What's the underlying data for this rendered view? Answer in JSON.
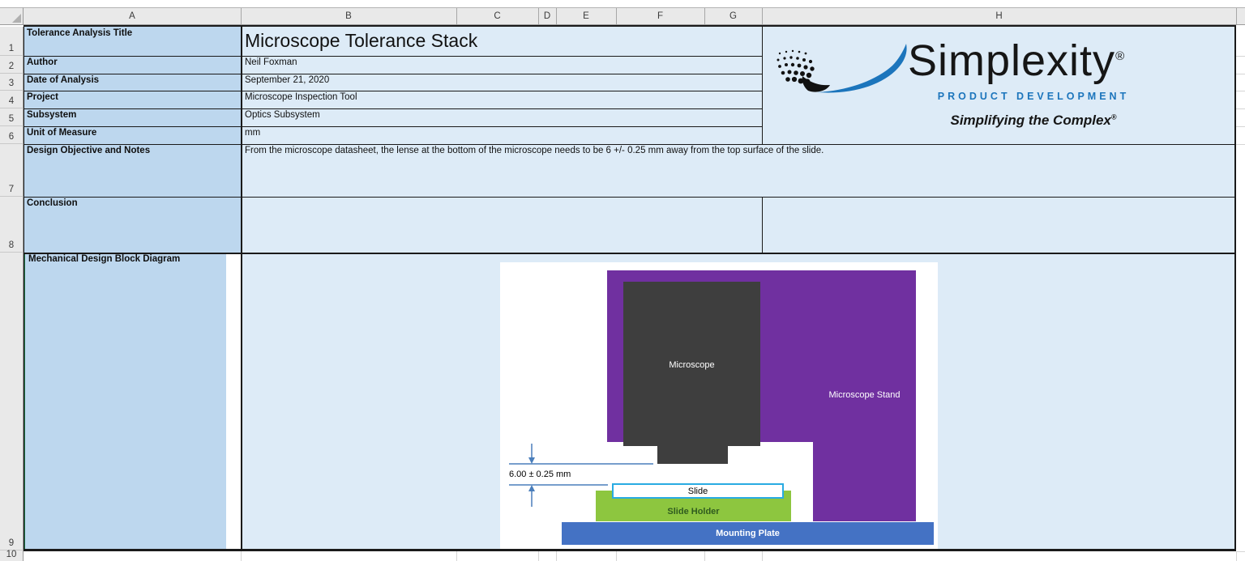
{
  "sheet": {
    "columns": [
      "A",
      "B",
      "C",
      "D",
      "E",
      "F",
      "G",
      "H"
    ],
    "row_numbers": [
      "1",
      "2",
      "3",
      "4",
      "5",
      "6",
      "7",
      "8",
      "9",
      "10"
    ],
    "fields": [
      {
        "label": "Tolerance Analysis Title",
        "value": "Microscope Tolerance Stack"
      },
      {
        "label": "Author",
        "value": "Neil Foxman"
      },
      {
        "label": "Date of Analysis",
        "value": "September 21, 2020"
      },
      {
        "label": "Project",
        "value": "Microscope Inspection Tool"
      },
      {
        "label": "Subsystem",
        "value": "Optics Subsystem"
      },
      {
        "label": "Unit of Measure",
        "value": "mm"
      },
      {
        "label": "Design Objective and Notes",
        "value": "From the microscope datasheet, the lense at the bottom of the microscope needs to be 6 +/- 0.25 mm away from the top surface of the slide."
      },
      {
        "label": "Conclusion",
        "value": ""
      },
      {
        "label": "Mechanical Design Block Diagram",
        "value": ""
      }
    ],
    "fill_colors": {
      "label_column": "#BDD7EE",
      "value_cells": "#DDEBF7"
    }
  },
  "logo": {
    "brand": "Simplexity",
    "registered_mark": "®",
    "subtitle": "PRODUCT DEVELOPMENT",
    "tagline": "Simplifying the Complex",
    "tagline_registered_mark": "®",
    "brand_color": "#161616",
    "accent_blue": "#1C75BC"
  },
  "diagram": {
    "dimension_label": "6.00 ± 0.25 mm",
    "dimension_color": "#4A7EBB",
    "blocks": [
      {
        "name": "Microscope",
        "color": "#3E3E3E",
        "text_color": "#FFFFFF"
      },
      {
        "name": "Microscope Stand",
        "color": "#7030A0",
        "text_color": "#FFFFFF"
      },
      {
        "name": "Slide",
        "color": "#FFFFFF",
        "border_color": "#29ABE2",
        "text_color": "#000000"
      },
      {
        "name": "Slide Holder",
        "color": "#8DC63F",
        "text_color": "#2F5B1F"
      },
      {
        "name": "Mounting Plate",
        "color": "#4472C4",
        "text_color": "#FFFFFF"
      }
    ]
  }
}
